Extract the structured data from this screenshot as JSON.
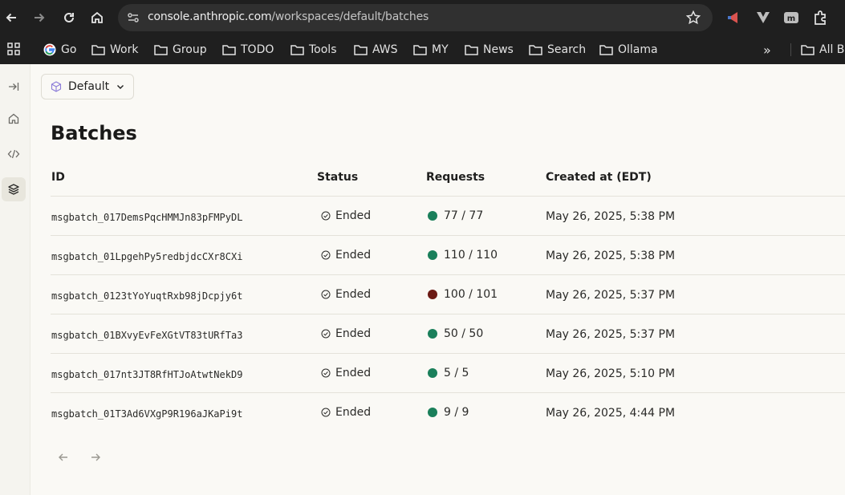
{
  "browser": {
    "url_host": "console.anthropic.com",
    "url_path": "/workspaces/default/batches"
  },
  "bookmarks": [
    {
      "label": "Go",
      "icon": "google-icon"
    },
    {
      "label": "Work",
      "icon": "folder-icon"
    },
    {
      "label": "Group",
      "icon": "folder-icon"
    },
    {
      "label": "TODO",
      "icon": "folder-icon"
    },
    {
      "label": "Tools",
      "icon": "folder-icon"
    },
    {
      "label": "AWS",
      "icon": "folder-icon"
    },
    {
      "label": "MY",
      "icon": "folder-icon"
    },
    {
      "label": "News",
      "icon": "folder-icon"
    },
    {
      "label": "Search",
      "icon": "folder-icon"
    },
    {
      "label": "Ollama",
      "icon": "folder-icon"
    }
  ],
  "bookmarks_overflow": "»",
  "all_bookmarks_label": "All B",
  "workspace": {
    "selected": "Default"
  },
  "page": {
    "title": "Batches"
  },
  "table": {
    "columns": [
      "ID",
      "Status",
      "Requests",
      "Created at (EDT)"
    ],
    "rows": [
      {
        "id": "msgbatch_017DemsPqcHMMJn83pFMPyDL",
        "status": "Ended",
        "requests": "77 / 77",
        "dot_color": "#1a7f5a",
        "created": "May 26, 2025, 5:38 PM"
      },
      {
        "id": "msgbatch_01LpgehPy5redbjdcCXr8CXi",
        "status": "Ended",
        "requests": "110 / 110",
        "dot_color": "#1a7f5a",
        "created": "May 26, 2025, 5:38 PM"
      },
      {
        "id": "msgbatch_0123tYoYuqtRxb98jDcpjy6t",
        "status": "Ended",
        "requests": "100 / 101",
        "dot_color": "#6b1a14",
        "created": "May 26, 2025, 5:37 PM"
      },
      {
        "id": "msgbatch_01BXvyEvFeXGtVT83tURfTa3",
        "status": "Ended",
        "requests": "50 / 50",
        "dot_color": "#1a7f5a",
        "created": "May 26, 2025, 5:37 PM"
      },
      {
        "id": "msgbatch_017nt3JT8RfHTJoAtwtNekD9",
        "status": "Ended",
        "requests": "5 / 5",
        "dot_color": "#1a7f5a",
        "created": "May 26, 2025, 5:10 PM"
      },
      {
        "id": "msgbatch_01T3Ad6VXgP9R196aJKaPi9t",
        "status": "Ended",
        "requests": "9 / 9",
        "dot_color": "#1a7f5a",
        "created": "May 26, 2025, 4:44 PM"
      }
    ]
  }
}
